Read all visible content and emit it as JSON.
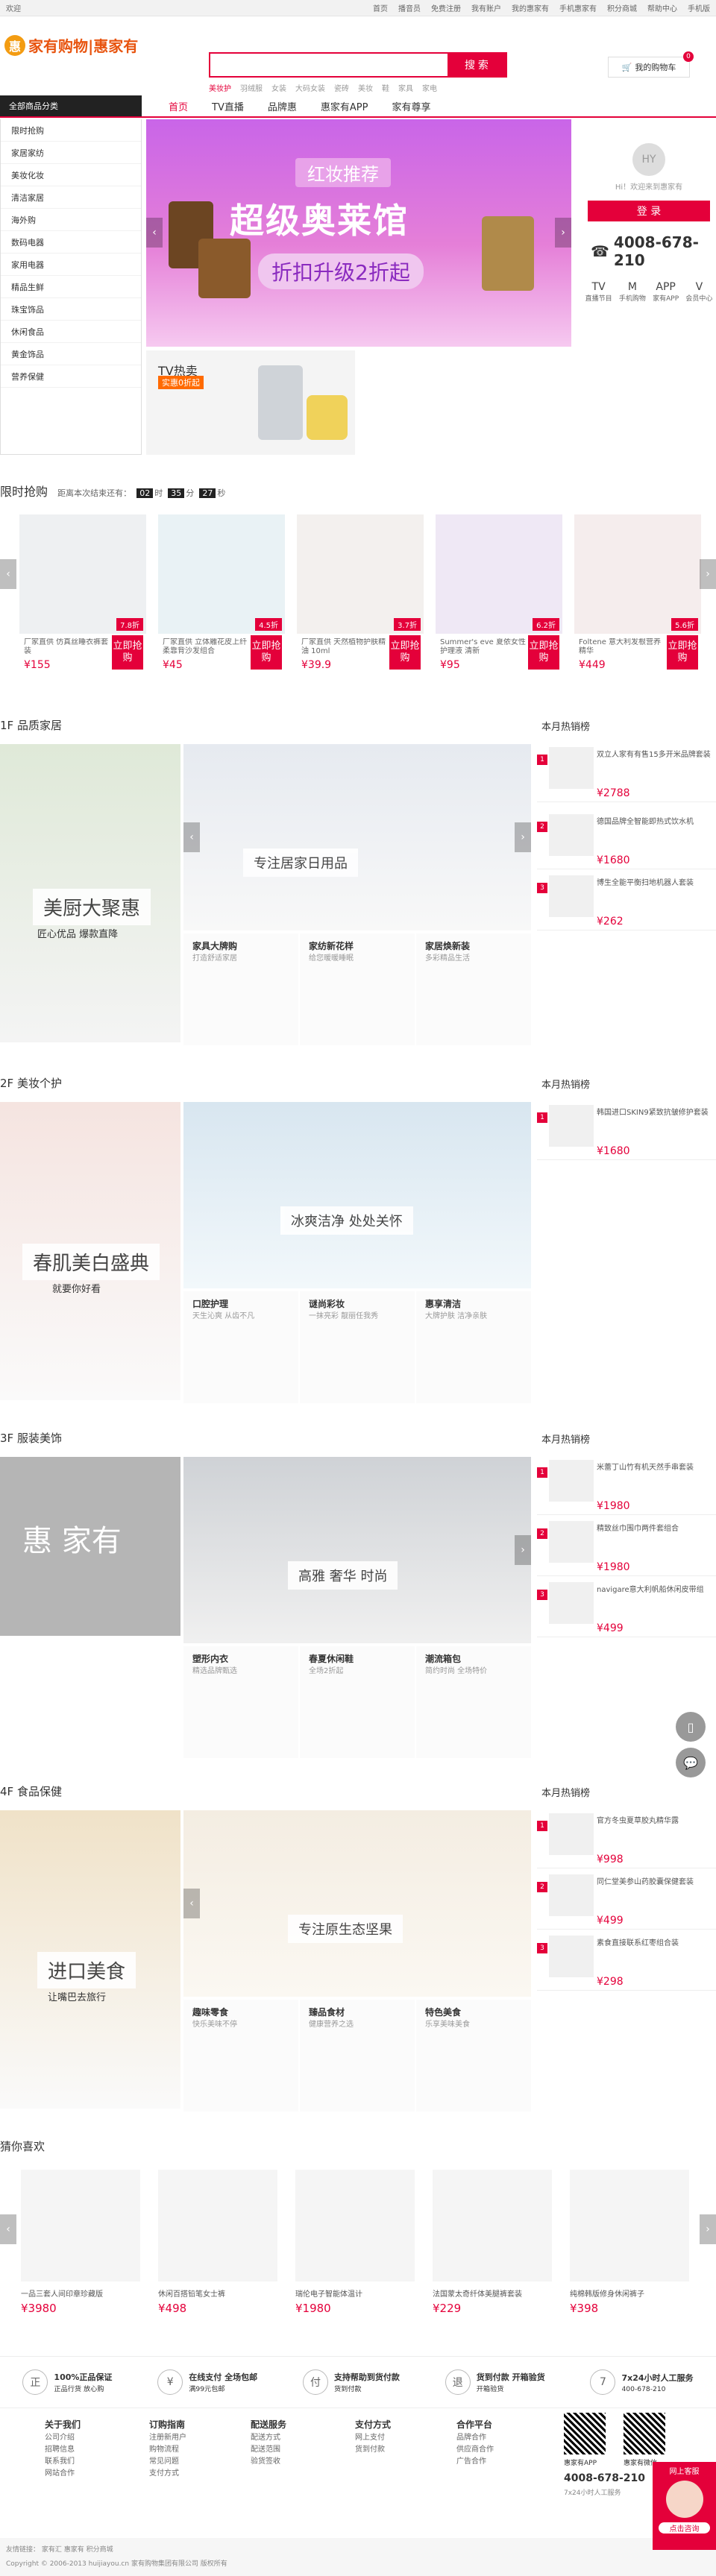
{
  "topbar": {
    "left": "欢迎",
    "links": [
      "首页",
      "播音员",
      "免费注册",
      "我有账户",
      "",
      "我的惠家有",
      "",
      "手机惠家有",
      "",
      "积分商城",
      "",
      "帮助中心",
      "",
      "手机版"
    ]
  },
  "header": {
    "logo_text": "家有购物|惠家有",
    "search_placeholder": "",
    "search_button": "搜 索",
    "hot_words": [
      "美妆护",
      "羽绒服",
      "女装",
      "大码女装",
      "瓷砖",
      "美妆",
      "鞋",
      "家具",
      "家电"
    ],
    "cart_label": "我的购物车",
    "cart_count": "0"
  },
  "nav": {
    "category_label": "全部商品分类",
    "items": [
      "首页",
      "TV直播",
      "品牌惠",
      "惠家有APP",
      "家有尊享"
    ]
  },
  "sidebar": {
    "items": [
      "限时抢购",
      "家居家纺",
      "美妆化妆",
      "清洁家居",
      "海外购",
      "数码电器",
      "家用电器",
      "精品生鲜",
      "珠宝饰品",
      "休闲食品",
      "黄金饰品",
      "营养保健"
    ]
  },
  "banner": {
    "tag": "红妆推荐",
    "title": "超级奥莱馆",
    "subtitle": "折扣升级2折起"
  },
  "user": {
    "greeting": "Hi！欢迎来到惠家有",
    "login": "登 录",
    "hotline": "4008-678-210",
    "quick": [
      {
        "icon": "TV",
        "label": "直播节目"
      },
      {
        "icon": "M",
        "label": "手机购物"
      },
      {
        "icon": "APP",
        "label": "家有APP"
      },
      {
        "icon": "V",
        "label": "会员中心"
      }
    ]
  },
  "tv": {
    "title": "TV热卖",
    "tag": "实惠0折起"
  },
  "flash": {
    "title": "限时抢购",
    "countdown_label": "距离本次结束还有：",
    "h": "02",
    "m": "35",
    "s": "27",
    "items": [
      {
        "discount": "7.8折",
        "name": "厂家直供 仿真丝睡衣裤套装",
        "price": "¥155"
      },
      {
        "discount": "4.5折",
        "name": "厂家直供 立体雕花皮上纤柔靠背沙发组合",
        "price": "¥45"
      },
      {
        "discount": "3.7折",
        "name": "厂家直供 天然植物护肤精油 10ml",
        "price": "¥39.9"
      },
      {
        "discount": "6.2折",
        "name": "Summer's eve 夏依女性护理液 清新",
        "price": "¥95"
      },
      {
        "discount": "5.6折",
        "name": "Foltene 意大利发根营养精华",
        "price": "¥449"
      }
    ],
    "buy_label": "立即抢购"
  },
  "floors": [
    {
      "title": "1F 品质家居",
      "left_text": "美厨大聚惠",
      "left_sub": "匠心优品 爆款直降",
      "main_text": "专注居家日用品",
      "subs": [
        {
          "t": "家具大牌购",
          "s": "打造舒适家居"
        },
        {
          "t": "家纺新花样",
          "s": "给您暖暖睡眠"
        },
        {
          "t": "家居焕新装",
          "s": "多彩精品生活"
        }
      ],
      "rank": [
        {
          "n": "双立人家有有售15多开米品牌套装",
          "p": "¥2788"
        },
        {
          "n": "德国品牌全智能即热式饮水机",
          "p": "¥1680"
        },
        {
          "n": "博生全能平衡扫地机器人套装",
          "p": "¥262"
        }
      ]
    },
    {
      "title": "2F 美妆个护",
      "left_text": "春肌美白盛典",
      "left_sub": "就要你好看",
      "main_text": "冰爽洁净 处处关怀",
      "subs": [
        {
          "t": "口腔护理",
          "s": "天生沁爽 从齿不凡"
        },
        {
          "t": "谜尚彩妆",
          "s": "一抹亮彩 靓丽任我秀"
        },
        {
          "t": "惠享清洁",
          "s": "大牌护肤 洁净亲肤"
        }
      ],
      "rank": [
        {
          "n": "韩国进口SKIN9紧致抗皱修护套装",
          "p": "¥1680"
        }
      ]
    },
    {
      "title": "3F 服装美饰",
      "left_text": "惠 家有",
      "left_sub": "",
      "main_text": "高雅 奢华 时尚",
      "subs": [
        {
          "t": "塑形内衣",
          "s": "精选品牌甄选"
        },
        {
          "t": "春夏休闲鞋",
          "s": "全场2折起"
        },
        {
          "t": "潮流箱包",
          "s": "简约时尚 全场特价"
        }
      ],
      "rank": [
        {
          "n": "米蕾丁山竹有机天然手串套装",
          "p": "¥1980"
        },
        {
          "n": "精致丝巾围巾两件套组合",
          "p": "¥1980"
        },
        {
          "n": "navigare意大利帆船休闲皮带组",
          "p": "¥499"
        }
      ]
    },
    {
      "title": "4F 食品保健",
      "left_text": "进口美食",
      "left_sub": "让嘴巴去旅行",
      "main_text": "专注原生态坚果",
      "subs": [
        {
          "t": "趣味零食",
          "s": "快乐美味不停"
        },
        {
          "t": "臻品食材",
          "s": "健康营养之选"
        },
        {
          "t": "特色美食",
          "s": "乐享美味美食"
        }
      ],
      "rank": [
        {
          "n": "官方冬虫夏草胶丸精华露",
          "p": "¥998"
        },
        {
          "n": "同仁堂美参山药胶囊保健套装",
          "p": "¥499"
        },
        {
          "n": "素食直接联系红枣组合装",
          "p": "¥298"
        }
      ]
    }
  ],
  "guess": {
    "title": "猜你喜欢",
    "items": [
      {
        "n": "一品三套人间印章珍藏版",
        "p": "¥3980"
      },
      {
        "n": "休闲百搭铅笔女士裤",
        "p": "¥498"
      },
      {
        "n": "瑞伦电子智能体温计",
        "p": "¥1980"
      },
      {
        "n": "法国蒙太奇纤体美腿裤套装",
        "p": "¥229"
      },
      {
        "n": "纯棉韩版修身休闲裤子",
        "p": "¥398"
      }
    ]
  },
  "service": [
    {
      "icon": "正",
      "t": "100%正品保证",
      "s": "正品行货 放心购"
    },
    {
      "icon": "¥",
      "t": "在线支付 全场包邮",
      "s": "满99元包邮"
    },
    {
      "icon": "付",
      "t": "支持帮助到货付款",
      "s": "货到付款"
    },
    {
      "icon": "退",
      "t": "货到付款 开箱验货",
      "s": "开箱验货"
    },
    {
      "icon": "7",
      "t": "7x24小时人工服务",
      "s": "400-678-210"
    }
  ],
  "footer": {
    "cols": [
      {
        "t": "关于我们",
        "items": [
          "公司介绍",
          "招聘信息",
          "联系我们",
          "网站合作"
        ]
      },
      {
        "t": "订购指南",
        "items": [
          "注册新用户",
          "购物流程",
          "常见问题",
          "支付方式"
        ]
      },
      {
        "t": "配送服务",
        "items": [
          "配送方式",
          "配送范围",
          "验货签收"
        ]
      },
      {
        "t": "支付方式",
        "items": [
          "网上支付",
          "货到付款"
        ]
      },
      {
        "t": "合作平台",
        "items": [
          "品牌合作",
          "供应商合作",
          "广告合作"
        ]
      }
    ],
    "qr1": "惠家有APP",
    "qr2": "惠家有微信",
    "phone": "4008-678-210",
    "phone_sub": "7x24小时人工服务",
    "bottom_links": "友情链接： 家有汇  惠家有  积分商城",
    "copyright": "Copyright © 2006-2013 huijiayou.cn 家有购物集团有限公司 版权所有"
  },
  "float": {
    "kf_label": "网上客服",
    "kf_sub": "点击咨询"
  }
}
